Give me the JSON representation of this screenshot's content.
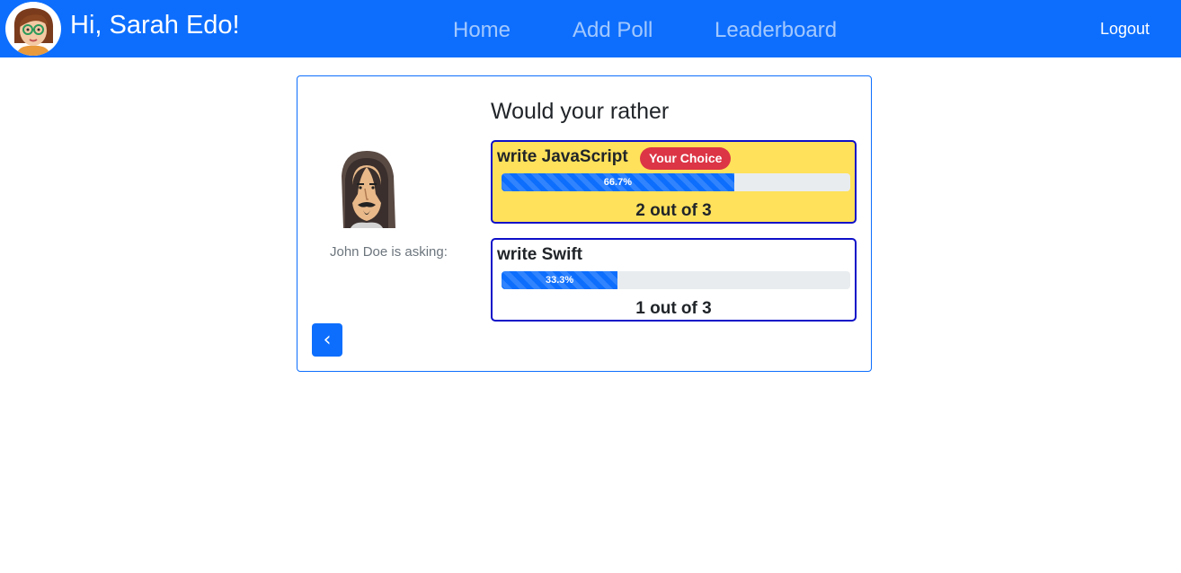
{
  "navbar": {
    "greeting": "Hi, Sarah Edo!",
    "links": [
      "Home",
      "Add Poll",
      "Leaderboard"
    ],
    "logout": "Logout",
    "user_avatar_icon": "woman-avatar-icon"
  },
  "poll": {
    "author_label": "John Doe is asking:",
    "author_avatar_icon": "man-avatar-icon",
    "question": "Would your rather",
    "options": [
      {
        "text": "write JavaScript",
        "badge": "Your Choice",
        "percent_label": "66.7%",
        "percent": 66.7,
        "count_text": "2 out of 3",
        "chosen": true
      },
      {
        "text": "write Swift",
        "badge": "",
        "percent_label": "33.3%",
        "percent": 33.3,
        "count_text": "1 out of 3",
        "chosen": false
      }
    ],
    "back_icon": "chevron-left-icon",
    "back_label": "‹"
  },
  "colors": {
    "primary": "#0d6efd",
    "chosen_background": "#ffe15b",
    "badge": "#dc3545",
    "option_border": "#0d0fc8"
  }
}
